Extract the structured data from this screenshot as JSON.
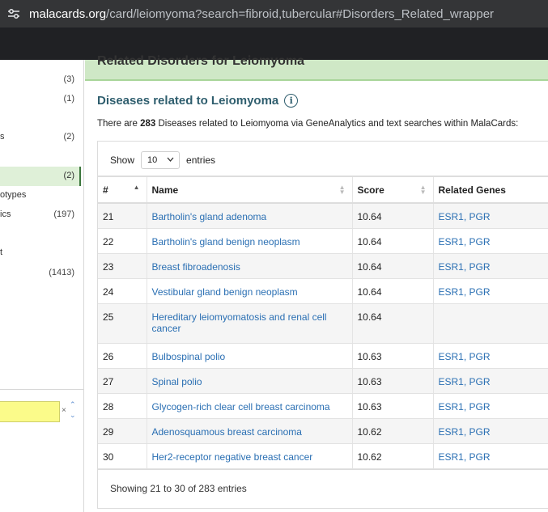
{
  "browser": {
    "url_domain": "malacards.org",
    "url_rest": "/card/leiomyoma?search=fibroid,tubercular#Disorders_Related_wrapper"
  },
  "sidebar": {
    "rows": [
      {
        "label": "",
        "count": "(3)"
      },
      {
        "label": "",
        "count": "(1)"
      },
      {
        "label": "s",
        "count": "(2)"
      },
      {
        "label": "",
        "count": "(2)"
      },
      {
        "label": "otypes",
        "count": ""
      },
      {
        "label": "ics",
        "count": "(197)"
      },
      {
        "label": "t",
        "count": ""
      },
      {
        "label": "",
        "count": "(1413)"
      }
    ],
    "search_clear": "×",
    "nav_up": "⌃",
    "nav_down": "⌄"
  },
  "main": {
    "section_header": "Related Disorders for Leiomyoma",
    "subtitle": "Diseases related to Leiomyoma",
    "info_icon": "i",
    "desc_prefix": "There are ",
    "desc_count": "283",
    "desc_suffix": " Diseases related to Leiomyoma via GeneAnalytics and text searches within MalaCards:",
    "show_label": "Show",
    "entries_value": "10",
    "entries_label": "entries",
    "columns": [
      "#",
      "Name",
      "Score",
      "Related Genes"
    ],
    "rows": [
      {
        "num": "21",
        "name": "Bartholin's gland adenoma",
        "score": "10.64",
        "genes": "ESR1, PGR"
      },
      {
        "num": "22",
        "name": "Bartholin's gland benign neoplasm",
        "score": "10.64",
        "genes": "ESR1, PGR"
      },
      {
        "num": "23",
        "name": "Breast fibroadenosis",
        "score": "10.64",
        "genes": "ESR1, PGR"
      },
      {
        "num": "24",
        "name": "Vestibular gland benign neoplasm",
        "score": "10.64",
        "genes": "ESR1, PGR"
      },
      {
        "num": "25",
        "name": "Hereditary leiomyomatosis and renal cell cancer",
        "score": "10.64",
        "genes": ""
      },
      {
        "num": "26",
        "name": "Bulbospinal polio",
        "score": "10.63",
        "genes": "ESR1, PGR"
      },
      {
        "num": "27",
        "name": "Spinal polio",
        "score": "10.63",
        "genes": "ESR1, PGR"
      },
      {
        "num": "28",
        "name": "Glycogen-rich clear cell breast carcinoma",
        "score": "10.63",
        "genes": "ESR1, PGR"
      },
      {
        "num": "29",
        "name": "Adenosquamous breast carcinoma",
        "score": "10.62",
        "genes": "ESR1, PGR"
      },
      {
        "num": "30",
        "name": "Her2-receptor negative breast cancer",
        "score": "10.62",
        "genes": "ESR1, PGR"
      }
    ],
    "footer": "Showing 21 to 30 of 283 entries"
  }
}
